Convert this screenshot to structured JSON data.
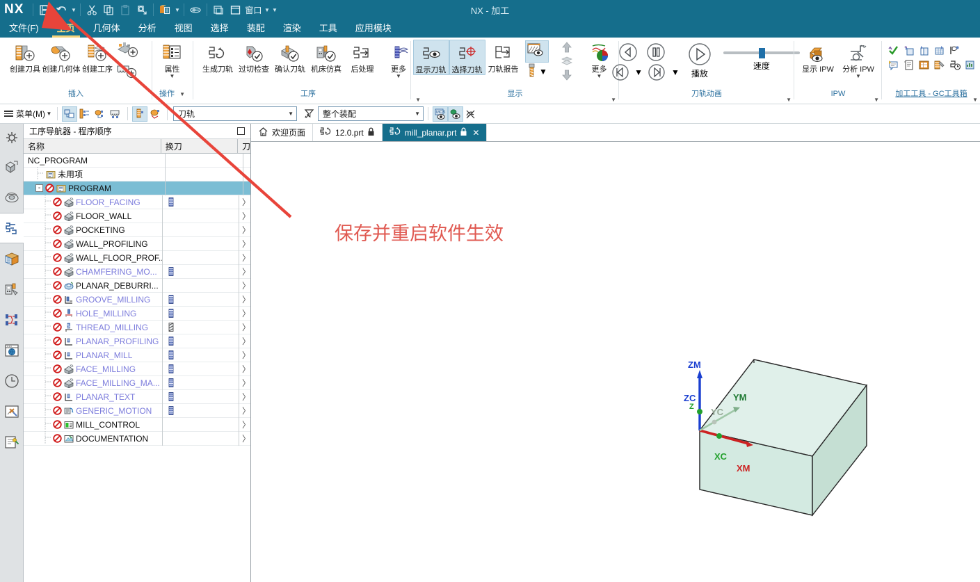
{
  "titlebar": {
    "logo": "NX",
    "title": "NX - 加工",
    "window_label": "窗口",
    "quick_access": [
      {
        "name": "save-icon",
        "label": "保存"
      },
      {
        "name": "undo-icon",
        "label": "撤销"
      },
      {
        "name": "cut-icon",
        "label": "剪切"
      },
      {
        "name": "copy-icon",
        "label": "复制"
      },
      {
        "name": "paste-icon",
        "label": "粘贴"
      },
      {
        "name": "paste-special-icon",
        "label": "选择性粘贴"
      },
      {
        "name": "layers-icon",
        "label": "图层"
      },
      {
        "name": "paint-icon",
        "label": "着色"
      },
      {
        "name": "tile-windows-icon",
        "label": "平铺窗口"
      },
      {
        "name": "window-icon",
        "label": "窗口"
      }
    ]
  },
  "menubar": {
    "tabs": [
      {
        "label": "文件(F)",
        "active": false
      },
      {
        "label": "主页",
        "active": true
      },
      {
        "label": "几何体",
        "active": false
      },
      {
        "label": "分析",
        "active": false
      },
      {
        "label": "视图",
        "active": false
      },
      {
        "label": "选择",
        "active": false
      },
      {
        "label": "装配",
        "active": false
      },
      {
        "label": "渲染",
        "active": false
      },
      {
        "label": "工具",
        "active": false
      },
      {
        "label": "应用模块",
        "active": false
      }
    ]
  },
  "ribbon": {
    "groups": [
      {
        "name": "insert",
        "label": "插入",
        "items": [
          {
            "label": "创建刀具",
            "icon": "create-tool-icon",
            "dropdown": false,
            "selected": false
          },
          {
            "label": "创建几何体",
            "icon": "create-geometry-icon",
            "dropdown": false,
            "selected": false
          },
          {
            "label": "创建工序",
            "icon": "create-operation-icon",
            "dropdown": false,
            "selected": false
          },
          {
            "label": "",
            "icon": "create-program-icon",
            "dropdown": false,
            "selected": false
          },
          {
            "label": "",
            "icon": "create-method-icon",
            "dropdown": false,
            "selected": false
          }
        ]
      },
      {
        "name": "operation",
        "label": "操作",
        "items": [
          {
            "label": "属性",
            "icon": "properties-icon",
            "dropdown": true,
            "selected": false
          }
        ]
      },
      {
        "name": "process",
        "label": "工序",
        "items": [
          {
            "label": "生成刀轨",
            "icon": "generate-toolpath-icon",
            "dropdown": false,
            "selected": false
          },
          {
            "label": "过切检查",
            "icon": "gouge-check-icon",
            "dropdown": false,
            "selected": false
          },
          {
            "label": "确认刀轨",
            "icon": "verify-toolpath-icon",
            "dropdown": false,
            "selected": false
          },
          {
            "label": "机床仿真",
            "icon": "machine-simulation-icon",
            "dropdown": false,
            "selected": false
          },
          {
            "label": "后处理",
            "icon": "post-process-icon",
            "dropdown": false,
            "selected": false
          },
          {
            "label": "更多",
            "icon": "more-process-icon",
            "dropdown": true,
            "selected": false
          }
        ]
      },
      {
        "name": "display",
        "label": "显示",
        "items": [
          {
            "label": "显示刀轨",
            "icon": "show-toolpath-icon",
            "dropdown": false,
            "selected": true
          },
          {
            "label": "选择刀轨",
            "icon": "select-toolpath-icon",
            "dropdown": false,
            "selected": true
          },
          {
            "label": "刀轨报告",
            "icon": "toolpath-report-icon",
            "dropdown": false,
            "selected": false
          },
          {
            "label": "",
            "icon": "display-section-icon",
            "dropdown": false,
            "selected": true
          },
          {
            "label": "",
            "icon": "tool-display-icon",
            "dropdown": true,
            "selected": false
          },
          {
            "label": "",
            "icon": "move-up-icon",
            "dropdown": false,
            "selected": false
          },
          {
            "label": "",
            "icon": "move-layer-icon",
            "dropdown": false,
            "selected": false
          },
          {
            "label": "",
            "icon": "move-down-icon",
            "dropdown": false,
            "selected": false
          },
          {
            "label": "更多",
            "icon": "more-display-icon",
            "dropdown": true,
            "selected": false
          }
        ]
      },
      {
        "name": "toolpath-animation",
        "label": "刀轨动画",
        "speed_label": "速度",
        "items": [
          {
            "label": "",
            "icon": "step-back-icon",
            "dropdown": false,
            "selected": false
          },
          {
            "label": "",
            "icon": "pause-icon",
            "dropdown": false,
            "selected": false
          },
          {
            "label": "播放",
            "icon": "play-icon",
            "dropdown": false,
            "selected": false
          },
          {
            "label": "",
            "icon": "rewind-icon",
            "dropdown": true,
            "selected": false
          },
          {
            "label": "",
            "icon": "forward-icon",
            "dropdown": true,
            "selected": false
          }
        ]
      },
      {
        "name": "ipw",
        "label": "IPW",
        "items": [
          {
            "label": "显示 IPW",
            "icon": "show-ipw-icon",
            "dropdown": false,
            "selected": false
          },
          {
            "label": "分析 IPW",
            "icon": "analyze-ipw-icon",
            "dropdown": true,
            "selected": false
          }
        ]
      },
      {
        "name": "gc-toolbox",
        "label": "加工工具 - GC工具箱",
        "items": [
          {
            "icon": "check-green-icon"
          },
          {
            "icon": "tool-blue-icon"
          },
          {
            "icon": "copy-blue-icon"
          },
          {
            "icon": "grid-blue-icon"
          },
          {
            "icon": "pointer-icon"
          },
          {
            "icon": "comment-icon"
          },
          {
            "icon": "document-icon"
          },
          {
            "icon": "table-icon"
          },
          {
            "icon": "wrench-icon"
          },
          {
            "icon": "time-icon"
          },
          {
            "icon": "report-icon"
          }
        ]
      }
    ]
  },
  "toolbar2": {
    "menu_label": "菜单(M)",
    "left_icons": [
      {
        "name": "program-order-view-icon",
        "selected": true
      },
      {
        "name": "machine-tool-view-icon",
        "selected": false
      },
      {
        "name": "geometry-view-icon",
        "selected": false
      },
      {
        "name": "machining-method-view-icon",
        "selected": false
      },
      {
        "name": "filter-view-icon",
        "selected": true
      },
      {
        "name": "object-display-icon",
        "selected": false
      }
    ],
    "combo_toolpath": {
      "value": "刀轨",
      "placeholder": "刀轨"
    },
    "filter_icon": "filter-icon",
    "combo_scope": {
      "value": "整个装配",
      "placeholder": "整个装配"
    },
    "right_icons": [
      {
        "name": "mcs-display-icon",
        "selected": true
      },
      {
        "name": "wcs-display-icon",
        "selected": true
      },
      {
        "name": "no-display-icon",
        "selected": false
      }
    ]
  },
  "rail": {
    "items": [
      {
        "name": "assembly-navigator-icon",
        "selected": false
      },
      {
        "name": "part-navigator-icon",
        "selected": false
      },
      {
        "name": "constraint-navigator-icon",
        "selected": false
      },
      {
        "name": "operation-navigator-icon",
        "selected": true
      },
      {
        "name": "reuse-library-icon",
        "selected": false
      },
      {
        "name": "machine-tool-navigator-icon",
        "selected": false
      },
      {
        "name": "process-filter-icon",
        "selected": false
      },
      {
        "name": "web-browser-icon",
        "selected": false
      },
      {
        "name": "history-icon",
        "selected": false
      },
      {
        "name": "system-tools-icon",
        "selected": false
      },
      {
        "name": "roles-icon",
        "selected": false
      }
    ]
  },
  "navigator": {
    "title": "工序导航器 - 程序顺序",
    "columns": [
      "名称",
      "换刀",
      "刀"
    ],
    "rows": [
      {
        "label": "NC_PROGRAM",
        "indent": 0,
        "icon": "none",
        "stop": false,
        "expander": "",
        "purple": false,
        "selected": false,
        "tool": "",
        "chevron": false
      },
      {
        "label": "未用项",
        "indent": 1,
        "icon": "program-group-icon",
        "stop": false,
        "expander": "",
        "purple": false,
        "selected": false,
        "tool": "",
        "chevron": false
      },
      {
        "label": "PROGRAM",
        "indent": 1,
        "icon": "program-group-icon",
        "stop": true,
        "expander": "-",
        "purple": false,
        "selected": true,
        "tool": "",
        "chevron": false
      },
      {
        "label": "FLOOR_FACING",
        "indent": 2,
        "icon": "milling-icon",
        "stop": true,
        "expander": "",
        "purple": true,
        "selected": false,
        "tool": "tool-bar",
        "chevron": true
      },
      {
        "label": "FLOOR_WALL",
        "indent": 2,
        "icon": "milling-icon",
        "stop": true,
        "expander": "",
        "purple": false,
        "selected": false,
        "tool": "",
        "chevron": true
      },
      {
        "label": "POCKETING",
        "indent": 2,
        "icon": "milling-icon",
        "stop": true,
        "expander": "",
        "purple": false,
        "selected": false,
        "tool": "",
        "chevron": true
      },
      {
        "label": "WALL_PROFILING",
        "indent": 2,
        "icon": "milling-icon",
        "stop": true,
        "expander": "",
        "purple": false,
        "selected": false,
        "tool": "",
        "chevron": true
      },
      {
        "label": "WALL_FLOOR_PROF...",
        "indent": 2,
        "icon": "milling-icon",
        "stop": true,
        "expander": "",
        "purple": false,
        "selected": false,
        "tool": "",
        "chevron": true
      },
      {
        "label": "CHAMFERING_MO...",
        "indent": 2,
        "icon": "milling-icon",
        "stop": true,
        "expander": "",
        "purple": true,
        "selected": false,
        "tool": "tool-bar",
        "chevron": true
      },
      {
        "label": "PLANAR_DEBURRI...",
        "indent": 2,
        "icon": "deburr-icon",
        "stop": true,
        "expander": "",
        "purple": false,
        "selected": false,
        "tool": "",
        "chevron": true
      },
      {
        "label": "GROOVE_MILLING",
        "indent": 2,
        "icon": "groove-icon",
        "stop": true,
        "expander": "",
        "purple": true,
        "selected": false,
        "tool": "tool-bar",
        "chevron": true
      },
      {
        "label": "HOLE_MILLING",
        "indent": 2,
        "icon": "hole-icon",
        "stop": true,
        "expander": "",
        "purple": true,
        "selected": false,
        "tool": "tool-bar",
        "chevron": true
      },
      {
        "label": "THREAD_MILLING",
        "indent": 2,
        "icon": "thread-icon",
        "stop": true,
        "expander": "",
        "purple": true,
        "selected": false,
        "tool": "tool-hatch",
        "chevron": true
      },
      {
        "label": "PLANAR_PROFILING",
        "indent": 2,
        "icon": "planar-icon",
        "stop": true,
        "expander": "",
        "purple": true,
        "selected": false,
        "tool": "tool-bar",
        "chevron": true
      },
      {
        "label": "PLANAR_MILL",
        "indent": 2,
        "icon": "planar-icon",
        "stop": true,
        "expander": "",
        "purple": true,
        "selected": false,
        "tool": "tool-bar",
        "chevron": true
      },
      {
        "label": "FACE_MILLING",
        "indent": 2,
        "icon": "milling-icon",
        "stop": true,
        "expander": "",
        "purple": true,
        "selected": false,
        "tool": "tool-bar",
        "chevron": true
      },
      {
        "label": "FACE_MILLING_MA...",
        "indent": 2,
        "icon": "milling-icon",
        "stop": true,
        "expander": "",
        "purple": true,
        "selected": false,
        "tool": "tool-bar",
        "chevron": true
      },
      {
        "label": "PLANAR_TEXT",
        "indent": 2,
        "icon": "planar-icon",
        "stop": true,
        "expander": "",
        "purple": true,
        "selected": false,
        "tool": "tool-bar",
        "chevron": true
      },
      {
        "label": "GENERIC_MOTION",
        "indent": 2,
        "icon": "generic-motion-icon",
        "stop": true,
        "expander": "",
        "purple": true,
        "selected": false,
        "tool": "tool-bar",
        "chevron": true
      },
      {
        "label": "MILL_CONTROL",
        "indent": 2,
        "icon": "mill-control-icon",
        "stop": true,
        "expander": "",
        "purple": false,
        "selected": false,
        "tool": "",
        "chevron": true
      },
      {
        "label": "DOCUMENTATION",
        "indent": 2,
        "icon": "documentation-icon",
        "stop": true,
        "expander": "",
        "purple": false,
        "selected": false,
        "tool": "",
        "chevron": true
      }
    ]
  },
  "doctabs": {
    "tabs": [
      {
        "label": "欢迎页面",
        "icon": "home-icon",
        "active": false,
        "locked": false,
        "closable": false
      },
      {
        "label": "12.0.prt",
        "icon": "part-icon",
        "active": false,
        "locked": true,
        "closable": false
      },
      {
        "label": "mill_planar.prt",
        "icon": "part-icon",
        "active": true,
        "locked": true,
        "closable": true
      }
    ]
  },
  "viewport": {
    "annotation": "保存并重启软件生效",
    "annotation_color": "#e05a52",
    "axes": [
      {
        "label": "ZM",
        "color": "#1a3fd0"
      },
      {
        "label": "ZC",
        "color": "#1a3fd0"
      },
      {
        "label": "Z",
        "color": "#22a02c"
      },
      {
        "label": "YM",
        "color": "#1f7a33"
      },
      {
        "label": "YC",
        "color": "#7d8f7d"
      },
      {
        "label": "XC",
        "color": "#22a02c"
      },
      {
        "label": "XM",
        "color": "#cc2222"
      }
    ],
    "model": {
      "name": "blockpart",
      "face_color": "#d6eae2",
      "edge_color": "#2a2a2a"
    }
  }
}
